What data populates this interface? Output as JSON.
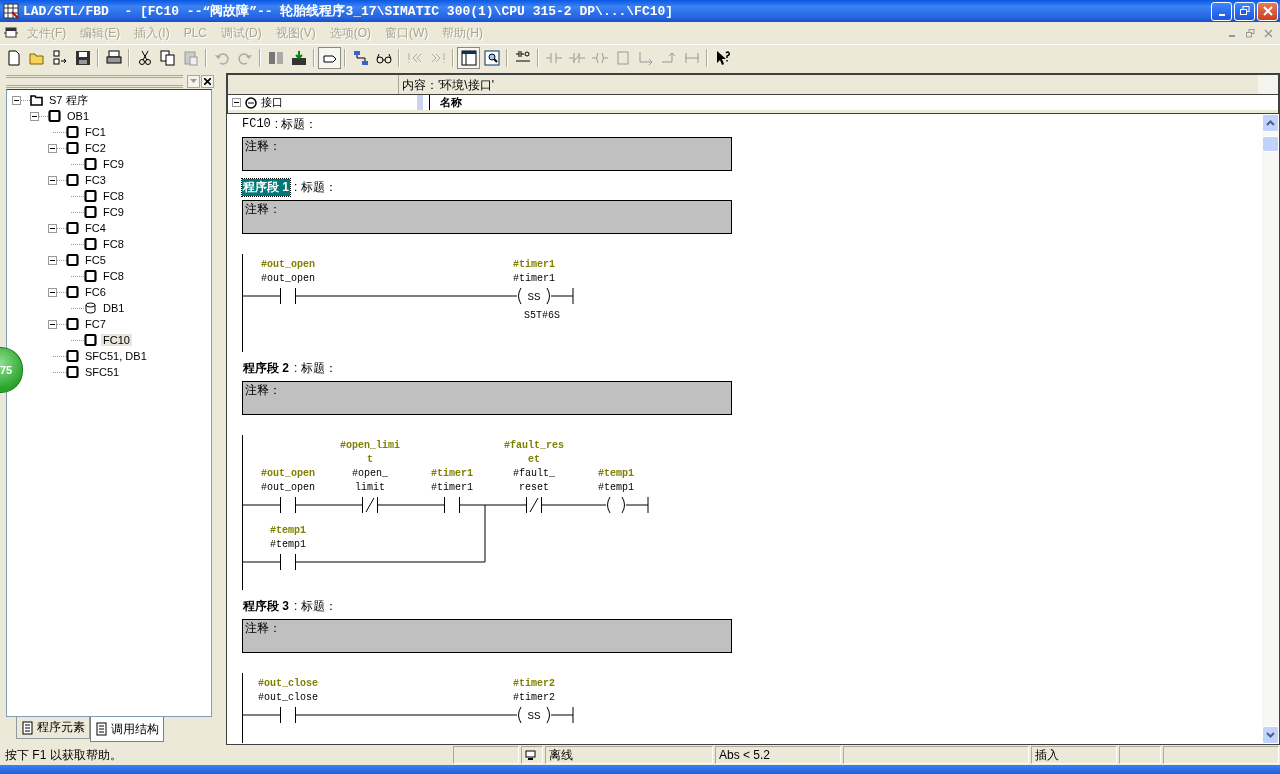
{
  "window": {
    "title": "LAD/STL/FBD  - [FC10 --“阀故障”-- 轮胎线程序3_17\\SIMATIC 300(1)\\CPU 315-2 DP\\...\\FC10]"
  },
  "menu": [
    "文件(F)",
    "编辑(E)",
    "插入(I)",
    "PLC",
    "调试(D)",
    "视图(V)",
    "选项(O)",
    "窗口(W)",
    "帮助(H)"
  ],
  "tree": [
    {
      "label": "S7 程序",
      "kind": "folder",
      "expanded": true,
      "selected": false,
      "children": [
        {
          "label": "OB1",
          "kind": "block",
          "expanded": true,
          "selected": false,
          "children": [
            {
              "label": "FC1",
              "kind": "block",
              "selected": false
            },
            {
              "label": "FC2",
              "kind": "block",
              "expanded": true,
              "selected": false,
              "children": [
                {
                  "label": "FC9",
                  "kind": "block",
                  "selected": false
                }
              ]
            },
            {
              "label": "FC3",
              "kind": "block",
              "expanded": true,
              "selected": false,
              "children": [
                {
                  "label": "FC8",
                  "kind": "block",
                  "selected": false
                },
                {
                  "label": "FC9",
                  "kind": "block",
                  "selected": false
                }
              ]
            },
            {
              "label": "FC4",
              "kind": "block",
              "expanded": true,
              "selected": false,
              "children": [
                {
                  "label": "FC8",
                  "kind": "block",
                  "selected": false
                }
              ]
            },
            {
              "label": "FC5",
              "kind": "block",
              "expanded": true,
              "selected": false,
              "children": [
                {
                  "label": "FC8",
                  "kind": "block",
                  "selected": false
                }
              ]
            },
            {
              "label": "FC6",
              "kind": "block",
              "expanded": true,
              "selected": false,
              "children": [
                {
                  "label": "DB1",
                  "kind": "db",
                  "selected": false
                }
              ]
            },
            {
              "label": "FC7",
              "kind": "block",
              "expanded": true,
              "selected": false,
              "children": [
                {
                  "label": "FC10",
                  "kind": "block",
                  "selected": true
                }
              ]
            },
            {
              "label": "SFC51, DB1",
              "kind": "block",
              "selected": false
            },
            {
              "label": "SFC51",
              "kind": "block",
              "selected": false
            }
          ]
        }
      ]
    }
  ],
  "left_tabs": [
    {
      "label": "程序元素",
      "selected": false
    },
    {
      "label": "调用结构",
      "selected": true
    }
  ],
  "badge": "75",
  "interface": {
    "content_header": "内容：'环境\\接口'",
    "tree_item": "接口",
    "column": "名称"
  },
  "block": {
    "name": "FC10",
    "title": ": 标题：",
    "comment": "注释："
  },
  "networks": [
    {
      "label": "程序段 1",
      "title": ": 标题：",
      "selected": true,
      "comment": "注释：",
      "rung": [
        {
          "kind": "contact_no",
          "symbol": "#out_open",
          "operand": "#out_open"
        },
        {
          "kind": "coil_ss",
          "symbol": "#timer1",
          "operand": "#timer1",
          "function": "SS",
          "parameter": "S5T#6S"
        }
      ]
    },
    {
      "label": "程序段 2",
      "title": ": 标题：",
      "selected": false,
      "comment": "注释：",
      "rung": [
        {
          "kind": "parallel",
          "branches": [
            [
              {
                "kind": "contact_no",
                "symbol": "#out_open",
                "operand": "#out_open"
              },
              {
                "kind": "contact_nc",
                "symbol": "#open_limit",
                "operand": "#open_limit"
              },
              {
                "kind": "contact_no",
                "symbol": "#timer1",
                "operand": "#timer1"
              }
            ],
            [
              {
                "kind": "contact_no",
                "symbol": "#temp1",
                "operand": "#temp1"
              }
            ]
          ]
        },
        {
          "kind": "contact_nc",
          "symbol": "#fault_reset",
          "operand": "#fault_reset"
        },
        {
          "kind": "coil",
          "symbol": "#temp1",
          "operand": "#temp1"
        }
      ]
    },
    {
      "label": "程序段 3",
      "title": ": 标题：",
      "selected": false,
      "comment": "注释：",
      "rung": [
        {
          "kind": "contact_no",
          "symbol": "#out_close",
          "operand": "#out_close"
        },
        {
          "kind": "coil_ss",
          "symbol": "#timer2",
          "operand": "#timer2",
          "function": "SS"
        }
      ]
    }
  ],
  "status_bar": {
    "help": "按下 F1 以获取帮助。",
    "mode": "离线",
    "address": "Abs < 5.2",
    "insert": "插入"
  }
}
